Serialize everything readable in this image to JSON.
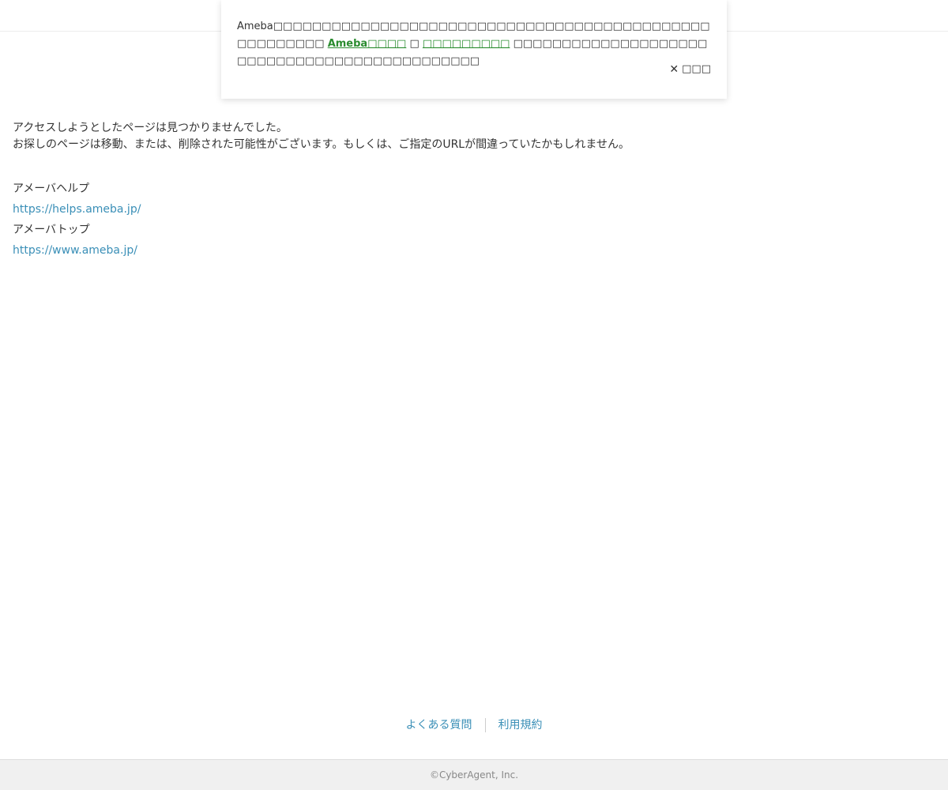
{
  "cookie_banner": {
    "text_before": "Ameba□□□□□□□□□□□□□□□□□□□□□□□□□□□□□□□□□□□□□□□□□□□□□□□□□□□□□□",
    "link_primary": "Ameba□□□□",
    "connector": "□",
    "link_secondary": "□□□□□□□□□",
    "text_after": "□□□□□□□□□□□□□□□□□□□□□□□□□□□□□□□□□□□□□□□□□□□□□",
    "close_label": "□□□",
    "close_icon": "close-icon",
    "link_color": "#2a8c2f"
  },
  "error": {
    "line1": "アクセスしようとしたページは見つかりませんでした。",
    "line2": "お探しのページは移動、または、削除された可能性がございます。もしくは、ご指定のURLが間違っていたかもしれません。"
  },
  "links": {
    "help_label": "アメーバヘルプ",
    "help_url": "https://helps.ameba.jp/",
    "top_label": "アメーバトップ",
    "top_url": "https://www.ameba.jp/"
  },
  "footer": {
    "faq": "よくある質問",
    "terms": "利用規約",
    "copyright": "©CyberAgent, Inc."
  },
  "colors": {
    "link": "#3a8fb7",
    "text": "#333333",
    "footer_bg": "#f0f0f0"
  }
}
